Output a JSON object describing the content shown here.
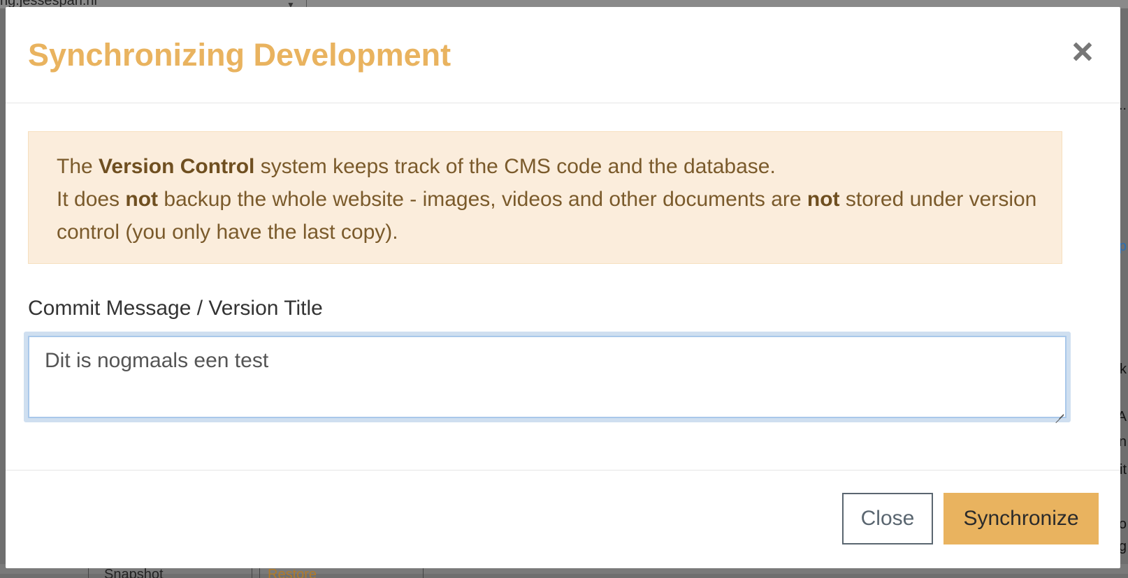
{
  "background": {
    "top_text": "ng.jessespan.nl",
    "right_fragments": [
      "..",
      "p",
      "k",
      "A",
      "n",
      "it",
      "o",
      "g"
    ],
    "bottom_buttons": [
      "Snapshot",
      "Restore"
    ]
  },
  "modal": {
    "title": "Synchronizing Development",
    "close_icon": "close-icon",
    "alert": {
      "line1_pre": "The ",
      "line1_bold": "Version Control",
      "line1_post": " system keeps track of the CMS code and the database.",
      "line2_pre": "It does ",
      "line2_bold1": "not",
      "line2_mid": " backup the whole website - images, videos and other documents are ",
      "line2_bold2": "not",
      "line2_post": " stored under version control (you only have the last copy)."
    },
    "field_label": "Commit Message / Version Title",
    "textarea_value": "Dit is nogmaals een test",
    "buttons": {
      "close": "Close",
      "synchronize": "Synchronize"
    }
  },
  "colors": {
    "accent": "#e9b35f",
    "alert_bg": "#fbeddc",
    "alert_text": "#7a5a2b"
  }
}
